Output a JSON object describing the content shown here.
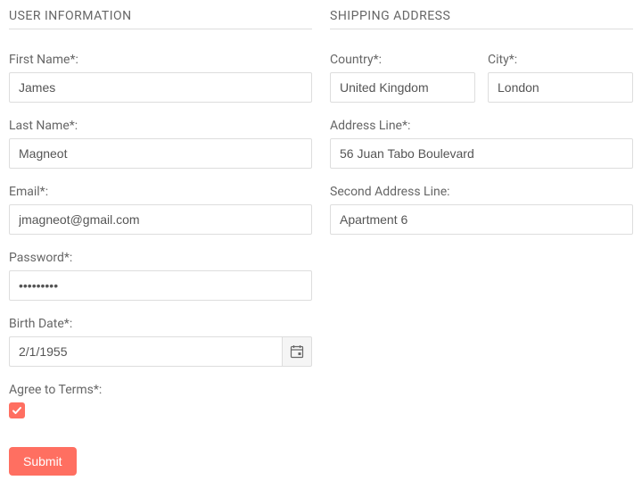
{
  "userInfo": {
    "header": "USER INFORMATION",
    "firstName": {
      "label": "First Name*:",
      "value": "James"
    },
    "lastName": {
      "label": "Last Name*:",
      "value": "Magneot"
    },
    "email": {
      "label": "Email*:",
      "value": "jmagneot@gmail.com"
    },
    "password": {
      "label": "Password*:",
      "value": "•••••••••"
    },
    "birthDate": {
      "label": "Birth Date*:",
      "value": "2/1/1955"
    },
    "agree": {
      "label": "Agree to Terms*:",
      "checked": true
    },
    "submit": "Submit"
  },
  "shipping": {
    "header": "SHIPPING ADDRESS",
    "country": {
      "label": "Country*:",
      "value": "United Kingdom"
    },
    "city": {
      "label": "City*:",
      "value": "London"
    },
    "addressLine": {
      "label": "Address Line*:",
      "value": "56 Juan Tabo Boulevard"
    },
    "secondAddressLine": {
      "label": "Second Address Line:",
      "value": "Apartment 6"
    }
  }
}
